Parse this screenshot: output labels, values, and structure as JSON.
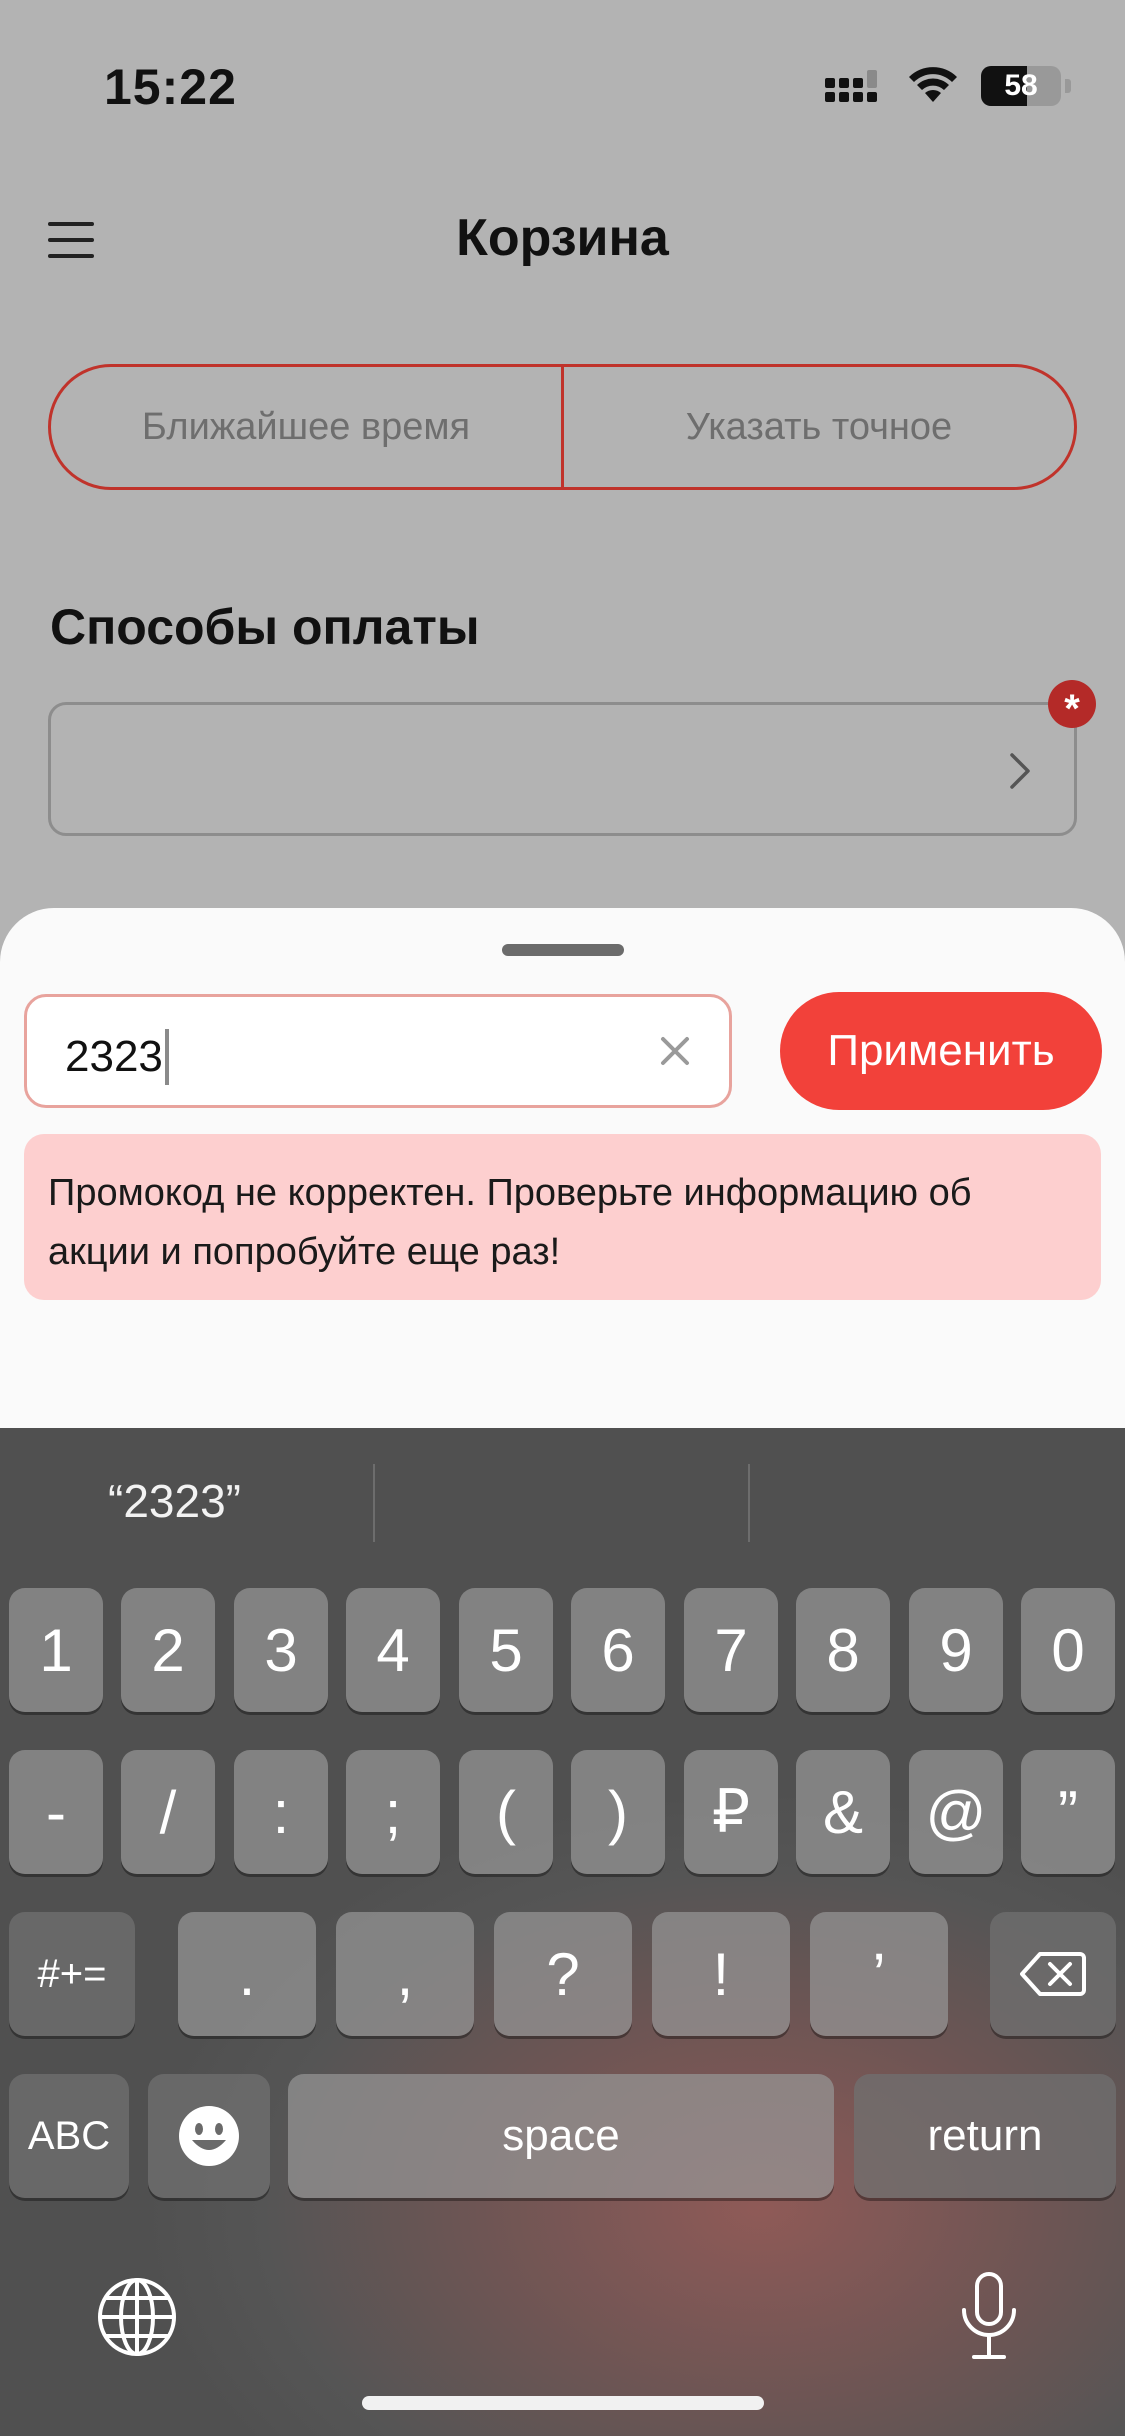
{
  "status_bar": {
    "time": "15:22",
    "battery_level": 58,
    "battery_label": "58",
    "icons": [
      "cellular-signal-icon",
      "wifi-icon",
      "battery-icon"
    ]
  },
  "header": {
    "title": "Корзина",
    "menu_icon": "hamburger-menu-icon"
  },
  "delivery_time": {
    "options": [
      "Ближайшее время",
      "Указать точное"
    ]
  },
  "payment": {
    "heading": "Способы оплаты",
    "selected": "",
    "required_mark": "*"
  },
  "promo": {
    "value": "2323",
    "apply_label": "Применить",
    "error": "Промокод не корректен. Проверьте информацию об акции и попробуйте еще раз!"
  },
  "keyboard": {
    "suggestions": [
      "“2323”",
      "",
      ""
    ],
    "row1": [
      "1",
      "2",
      "3",
      "4",
      "5",
      "6",
      "7",
      "8",
      "9",
      "0"
    ],
    "row2": [
      "-",
      "/",
      ":",
      ";",
      "(",
      ")",
      "₽",
      "&",
      "@",
      "”"
    ],
    "row3_left": "#+=",
    "row3": [
      ".",
      ",",
      "?",
      "!",
      "’"
    ],
    "row4_left": "ABC",
    "space": "space",
    "return": "return"
  },
  "colors": {
    "accent": "#f2413a",
    "border_red": "#c0332b",
    "error_bg": "#fdcfcf",
    "overlay": "#b3b3b3"
  }
}
